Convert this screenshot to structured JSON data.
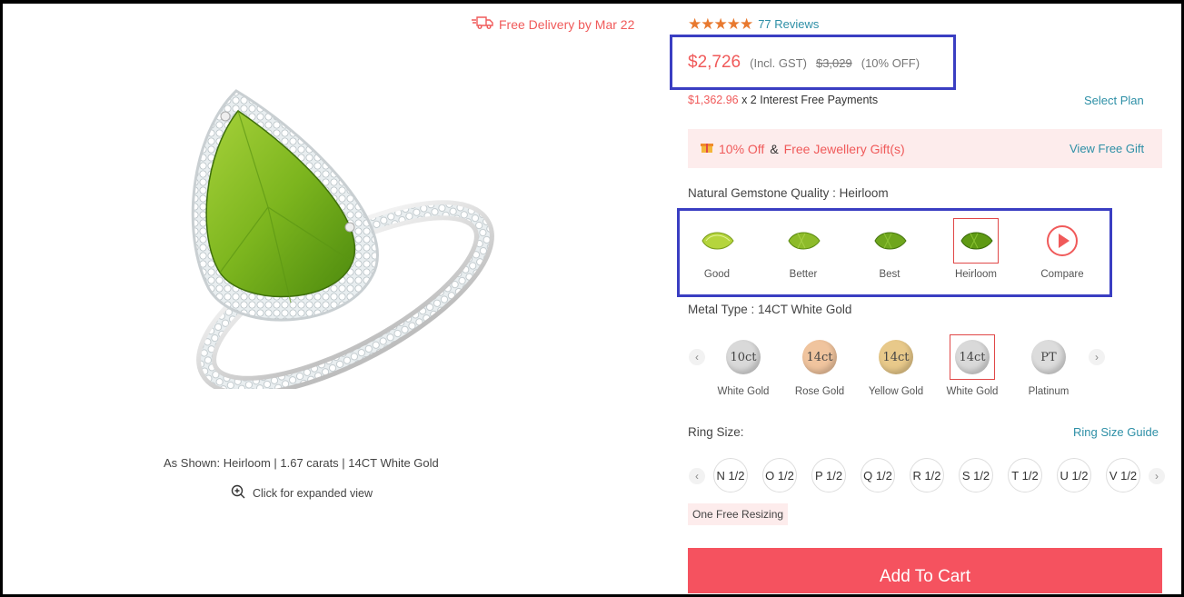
{
  "delivery": {
    "text": "Free Delivery by Mar 22",
    "icon": "truck-icon"
  },
  "product": {
    "as_shown": "As Shown: Heirloom | 1.67 carats | 14CT White Gold",
    "expand_text": "Click for expanded view",
    "image_alt": "Pear-shaped peridot halo ring"
  },
  "rating": {
    "stars": 5,
    "reviews": "77 Reviews"
  },
  "price": {
    "current": "$2,726",
    "gst": "(Incl. GST)",
    "original": "$3,029",
    "discount": "(10% OFF)"
  },
  "emi": {
    "amount": "$1,362.96",
    "rest": " x 2 Interest Free Payments",
    "select_plan": "Select Plan"
  },
  "offer": {
    "percent": "10% Off",
    "amp": "&",
    "gift": "Free Jewellery Gift(s)",
    "view": "View Free Gift"
  },
  "gemstone": {
    "label": "Natural Gemstone Quality : Heirloom",
    "options": [
      {
        "label": "Good",
        "selected": false
      },
      {
        "label": "Better",
        "selected": false
      },
      {
        "label": "Best",
        "selected": false
      },
      {
        "label": "Heirloom",
        "selected": true
      },
      {
        "label": "Compare",
        "selected": false
      }
    ]
  },
  "metal": {
    "label": "Metal Type : 14CT White Gold",
    "options": [
      {
        "code": "10ct",
        "label": "White Gold",
        "color": "#d9d9d9",
        "selected": false
      },
      {
        "code": "14ct",
        "label": "Rose Gold",
        "color": "#f0c49e",
        "selected": false
      },
      {
        "code": "14ct",
        "label": "Yellow Gold",
        "color": "#e8c98a",
        "selected": false
      },
      {
        "code": "14ct",
        "label": "White Gold",
        "color": "#d9d9d9",
        "selected": true
      },
      {
        "code": "PT",
        "label": "Platinum",
        "color": "#dcdcdc",
        "selected": false
      }
    ]
  },
  "ring_size": {
    "label": "Ring Size:",
    "guide": "Ring Size Guide",
    "sizes": [
      "N 1/2",
      "O 1/2",
      "P 1/2",
      "Q 1/2",
      "R 1/2",
      "S 1/2",
      "T 1/2",
      "U 1/2",
      "V 1/2"
    ],
    "free_resize": "One Free Resizing"
  },
  "cart": {
    "label": "Add To Cart"
  },
  "colors": {
    "accent": "#f05a5a",
    "link": "#2d8fa6",
    "highlight_box": "#3a3ec2",
    "button": "#f5525f",
    "star": "#e8792f"
  }
}
